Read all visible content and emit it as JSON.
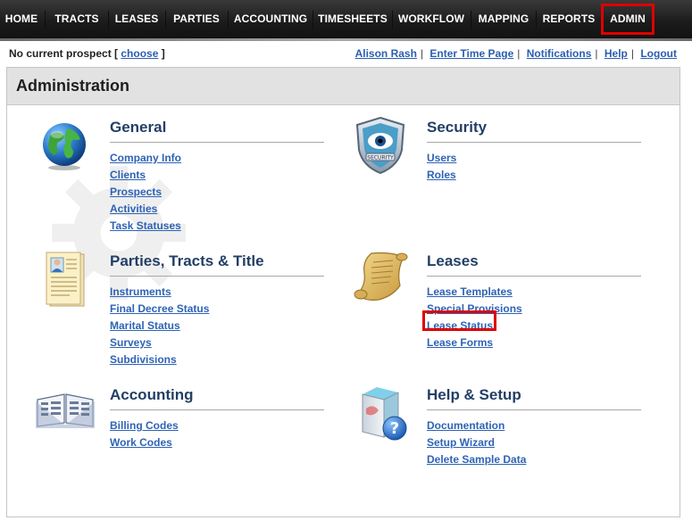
{
  "nav": {
    "items": [
      "HOME",
      "TRACTS",
      "LEASES",
      "PARTIES",
      "ACCOUNTING",
      "TIMESHEETS",
      "WORKFLOW",
      "MAPPING",
      "REPORTS",
      "ADMIN"
    ],
    "active": "ADMIN"
  },
  "status": {
    "prospect_text": "No current prospect [",
    "prospect_link": "choose",
    "prospect_close": "]",
    "user_links": [
      "Alison Rash",
      "Enter Time Page",
      "Notifications",
      "Help",
      "Logout"
    ]
  },
  "panel": {
    "title": "Administration"
  },
  "sections": {
    "general": {
      "title": "General",
      "icon": "globe-icon",
      "links": [
        "Company Info",
        "Clients",
        "Prospects",
        "Activities",
        "Task Statuses"
      ]
    },
    "security": {
      "title": "Security",
      "icon": "security-shield-icon",
      "links": [
        "Users",
        "Roles"
      ]
    },
    "parties": {
      "title": "Parties, Tracts & Title",
      "icon": "document-person-icon",
      "links": [
        "Instruments",
        "Final Decree Status",
        "Marital Status",
        "Surveys",
        "Subdivisions"
      ]
    },
    "leases": {
      "title": "Leases",
      "icon": "scroll-icon",
      "links": [
        "Lease Templates",
        "Special Provisions",
        "Lease Status",
        "Lease Forms"
      ]
    },
    "accounting": {
      "title": "Accounting",
      "icon": "open-book-icon",
      "links": [
        "Billing Codes",
        "Work Codes"
      ]
    },
    "help": {
      "title": "Help & Setup",
      "icon": "help-box-icon",
      "links": [
        "Documentation",
        "Setup Wizard",
        "Delete Sample Data"
      ]
    }
  },
  "colors": {
    "nav_bg": "#1c1c1c",
    "highlight": "#e00000",
    "link": "#2e63b5",
    "section_title": "#223f66"
  }
}
